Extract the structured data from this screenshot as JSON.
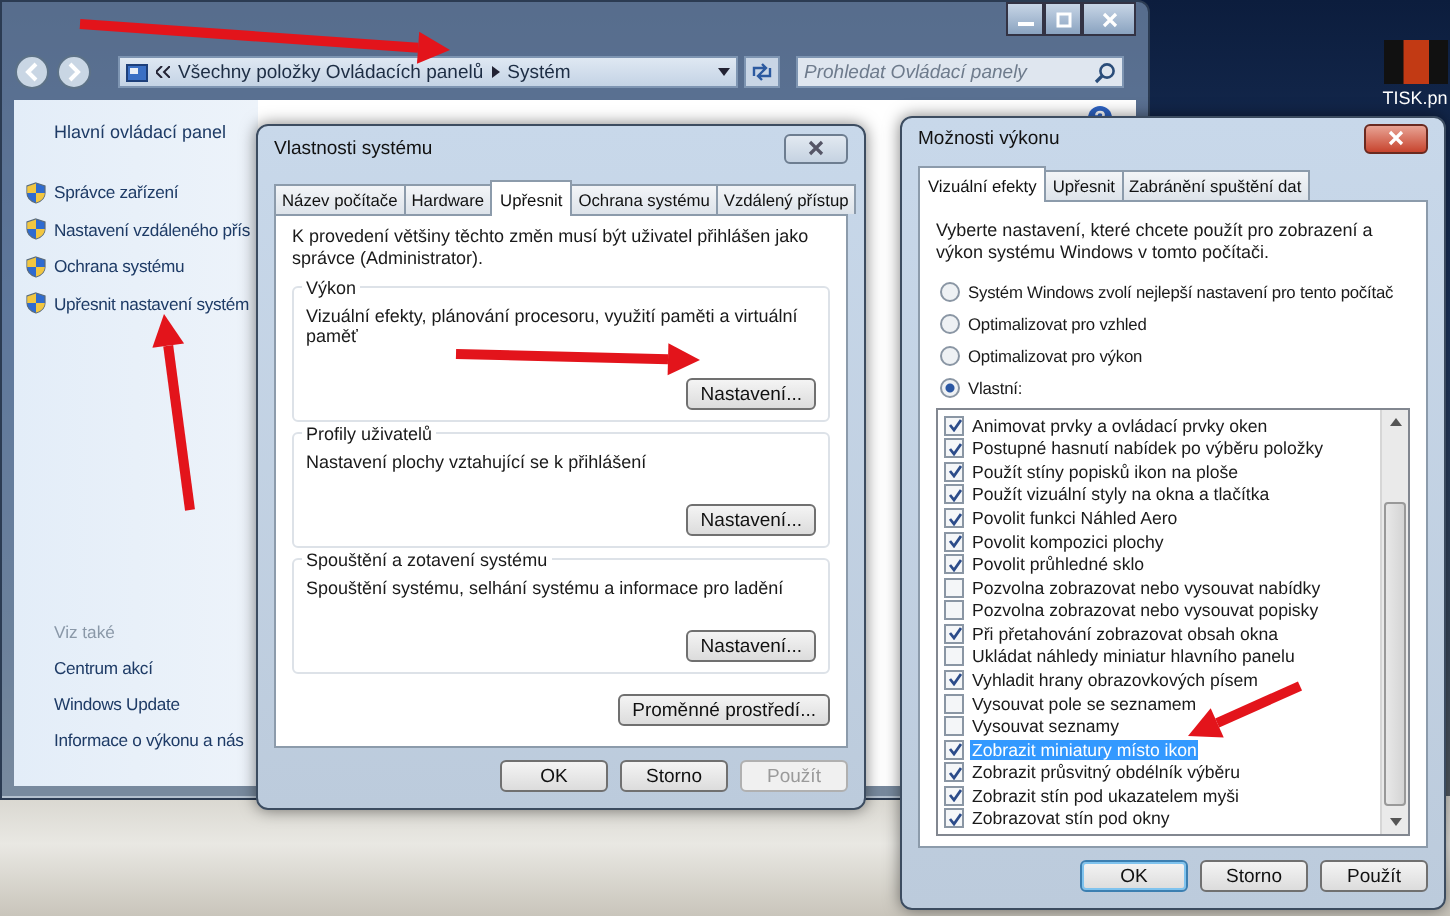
{
  "explorer": {
    "address": {
      "crumbs": [
        "Všechny položky Ovládacích panelů",
        "Systém"
      ]
    },
    "search": {
      "placeholder": "Prohledat Ovládací panely"
    },
    "sidebar": {
      "home": "Hlavní ovládací panel",
      "links": [
        "Správce zařízení",
        "Nastavení vzdáleného přís",
        "Ochrana systému",
        "Upřesnit nastavení systém"
      ],
      "see_also_title": "Viz také",
      "see_also": [
        "Centrum akcí",
        "Windows Update",
        "Informace o výkonu a nás"
      ]
    }
  },
  "desktop_icon": {
    "label": "TISK.pn"
  },
  "system_properties": {
    "title": "Vlastnosti systému",
    "tabs": [
      {
        "label": "Název počítače",
        "selected": false
      },
      {
        "label": "Hardware",
        "selected": false
      },
      {
        "label": "Upřesnit",
        "selected": true
      },
      {
        "label": "Ochrana systému",
        "selected": false
      },
      {
        "label": "Vzdálený přístup",
        "selected": false
      }
    ],
    "note": "K provedení většiny těchto změn musí být uživatel přihlášen jako správce (Administrator).",
    "groups": [
      {
        "title": "Výkon",
        "text": "Vizuální efekty, plánování procesoru, využití paměti a virtuální paměť",
        "button": "Nastavení..."
      },
      {
        "title": "Profily uživatelů",
        "text": "Nastavení plochy vztahující se k přihlášení",
        "button": "Nastavení..."
      },
      {
        "title": "Spouštění a zotavení systému",
        "text": "Spouštění systému, selhání systému a informace pro ladění",
        "button": "Nastavení..."
      }
    ],
    "env_button": "Proměnné prostředí...",
    "buttons": [
      {
        "label": "OK",
        "default": false,
        "disabled": false
      },
      {
        "label": "Storno",
        "default": false,
        "disabled": false
      },
      {
        "label": "Použít",
        "default": false,
        "disabled": true
      }
    ]
  },
  "performance_options": {
    "title": "Možnosti výkonu",
    "tabs": [
      {
        "label": "Vizuální efekty",
        "selected": true
      },
      {
        "label": "Upřesnit",
        "selected": false
      },
      {
        "label": "Zabránění spuštění dat",
        "selected": false
      }
    ],
    "intro": "Vyberte nastavení, které chcete použít pro zobrazení a výkon systému Windows v tomto počítači.",
    "options": [
      {
        "label": "Systém Windows zvolí nejlepší nastavení pro tento počítač",
        "selected": false
      },
      {
        "label": "Optimalizovat pro vzhled",
        "selected": false
      },
      {
        "label": "Optimalizovat pro výkon",
        "selected": false
      },
      {
        "label": "Vlastní:",
        "selected": true
      }
    ],
    "effects": [
      {
        "label": "Animovat prvky a ovládací prvky oken",
        "checked": true,
        "selected": false
      },
      {
        "label": "Postupné hasnutí nabídek po výběru položky",
        "checked": true,
        "selected": false
      },
      {
        "label": "Použít stíny popisků ikon na ploše",
        "checked": true,
        "selected": false
      },
      {
        "label": "Použít vizuální styly na okna a tlačítka",
        "checked": true,
        "selected": false
      },
      {
        "label": "Povolit funkci Náhled Aero",
        "checked": true,
        "selected": false
      },
      {
        "label": "Povolit kompozici plochy",
        "checked": true,
        "selected": false
      },
      {
        "label": "Povolit průhledné sklo",
        "checked": true,
        "selected": false
      },
      {
        "label": "Pozvolna zobrazovat nebo vysouvat nabídky",
        "checked": false,
        "selected": false
      },
      {
        "label": "Pozvolna zobrazovat nebo vysouvat popisky",
        "checked": false,
        "selected": false
      },
      {
        "label": "Při přetahování zobrazovat obsah okna",
        "checked": true,
        "selected": false
      },
      {
        "label": "Ukládat náhledy miniatur hlavního panelu",
        "checked": false,
        "selected": false
      },
      {
        "label": "Vyhladit hrany obrazovkových písem",
        "checked": true,
        "selected": false
      },
      {
        "label": "Vysouvat pole se seznamem",
        "checked": false,
        "selected": false
      },
      {
        "label": "Vysouvat seznamy",
        "checked": false,
        "selected": false
      },
      {
        "label": "Zobrazit miniatury místo ikon",
        "checked": true,
        "selected": true
      },
      {
        "label": "Zobrazit průsvitný obdélník výběru",
        "checked": true,
        "selected": false
      },
      {
        "label": "Zobrazit stín pod ukazatelem myši",
        "checked": true,
        "selected": false
      },
      {
        "label": "Zobrazovat stín pod okny",
        "checked": true,
        "selected": false
      }
    ],
    "buttons": [
      {
        "label": "OK",
        "default": true,
        "disabled": false
      },
      {
        "label": "Storno",
        "default": false,
        "disabled": false
      },
      {
        "label": "Použít",
        "default": false,
        "disabled": false
      }
    ]
  }
}
